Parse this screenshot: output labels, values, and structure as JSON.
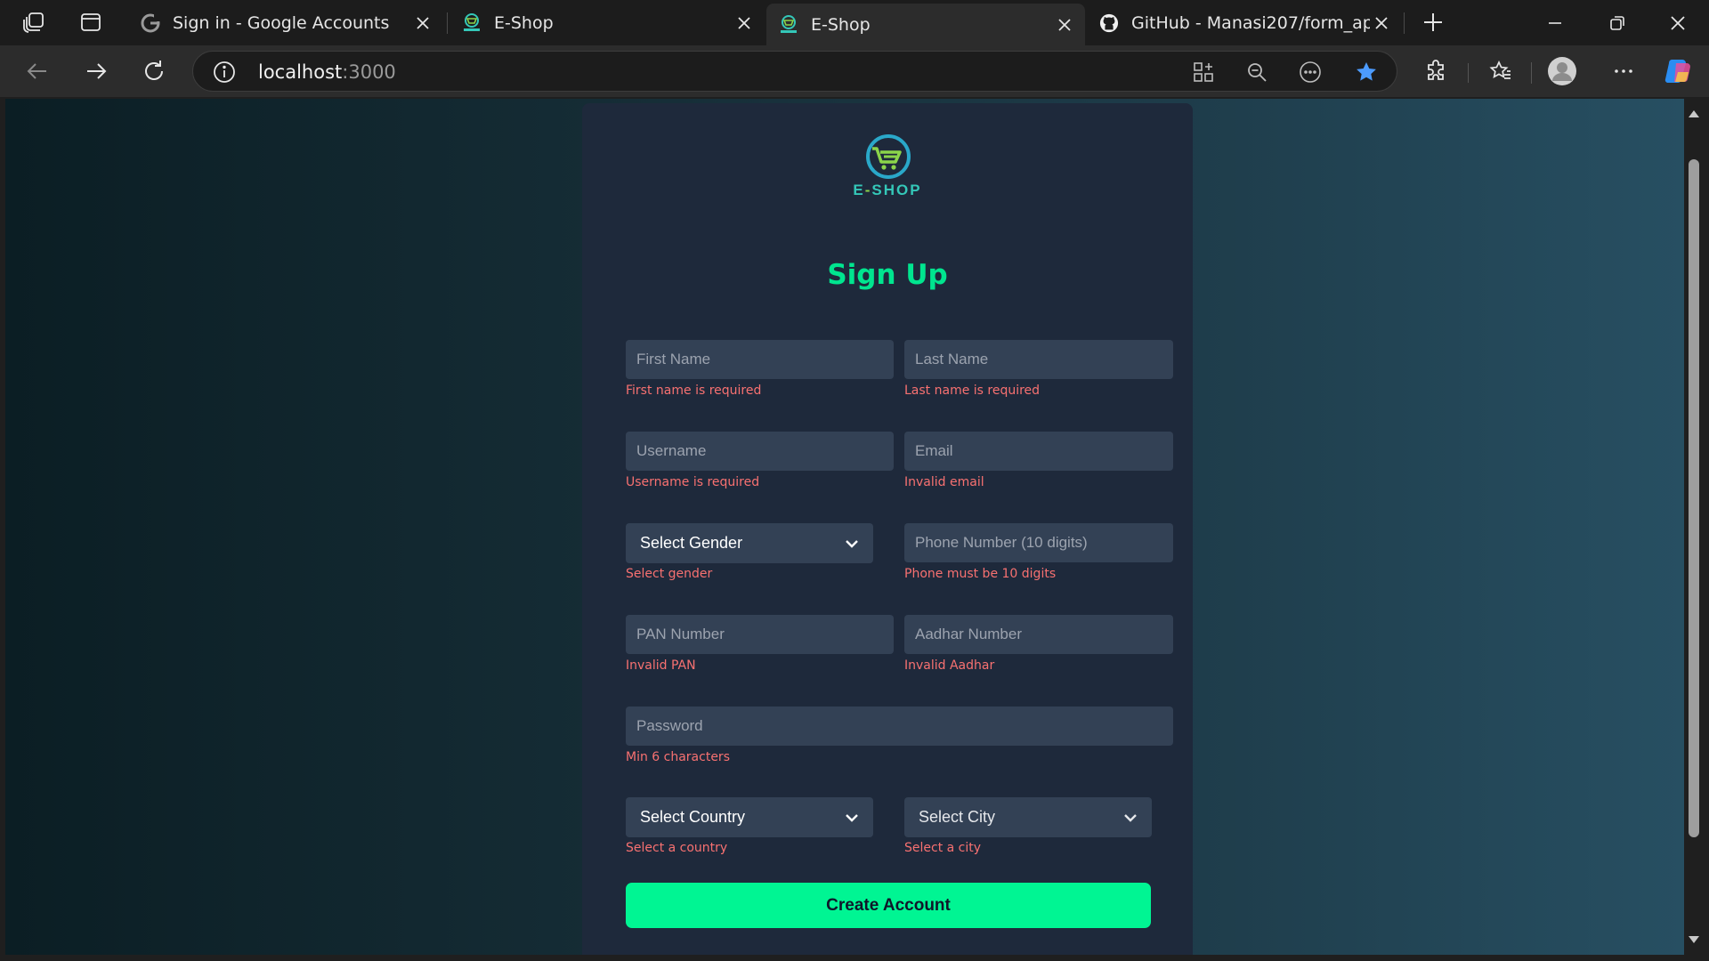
{
  "browser": {
    "tabs": [
      {
        "title": "Sign in - Google Accounts",
        "favicon": "google-icon",
        "active": false
      },
      {
        "title": "E-Shop",
        "favicon": "eshop-favicon",
        "active": false
      },
      {
        "title": "E-Shop",
        "favicon": "eshop-favicon",
        "active": true
      },
      {
        "title": "GitHub - Manasi207/form_app",
        "favicon": "github-icon",
        "active": false
      }
    ],
    "address": {
      "host": "localhost",
      "port": ":3000"
    }
  },
  "page": {
    "brand": {
      "name_part1": "E",
      "name_dash": "-",
      "name_part2": "SHOP"
    },
    "title": "Sign Up",
    "fields": {
      "first_name": {
        "placeholder": "First Name",
        "error": "First name is required"
      },
      "last_name": {
        "placeholder": "Last Name",
        "error": "Last name is required"
      },
      "username": {
        "placeholder": "Username",
        "error": "Username is required"
      },
      "email": {
        "placeholder": "Email",
        "error": "Invalid email"
      },
      "gender": {
        "value": "Select Gender",
        "error": "Select gender"
      },
      "phone": {
        "placeholder": "Phone Number (10 digits)",
        "error": "Phone must be 10 digits"
      },
      "pan": {
        "placeholder": "PAN Number",
        "error": "Invalid PAN"
      },
      "aadhar": {
        "placeholder": "Aadhar Number",
        "error": "Invalid Aadhar"
      },
      "password": {
        "placeholder": "Password",
        "error": "Min 6 characters"
      },
      "country": {
        "value": "Select Country",
        "error": "Select a country"
      },
      "city": {
        "value": "Select City",
        "error": "Select a city"
      }
    },
    "submit_label": "Create Account"
  },
  "colors": {
    "accent": "#00f593",
    "title": "#00e58f",
    "error": "#f87171",
    "card": "#1e293b",
    "input": "#334155"
  }
}
